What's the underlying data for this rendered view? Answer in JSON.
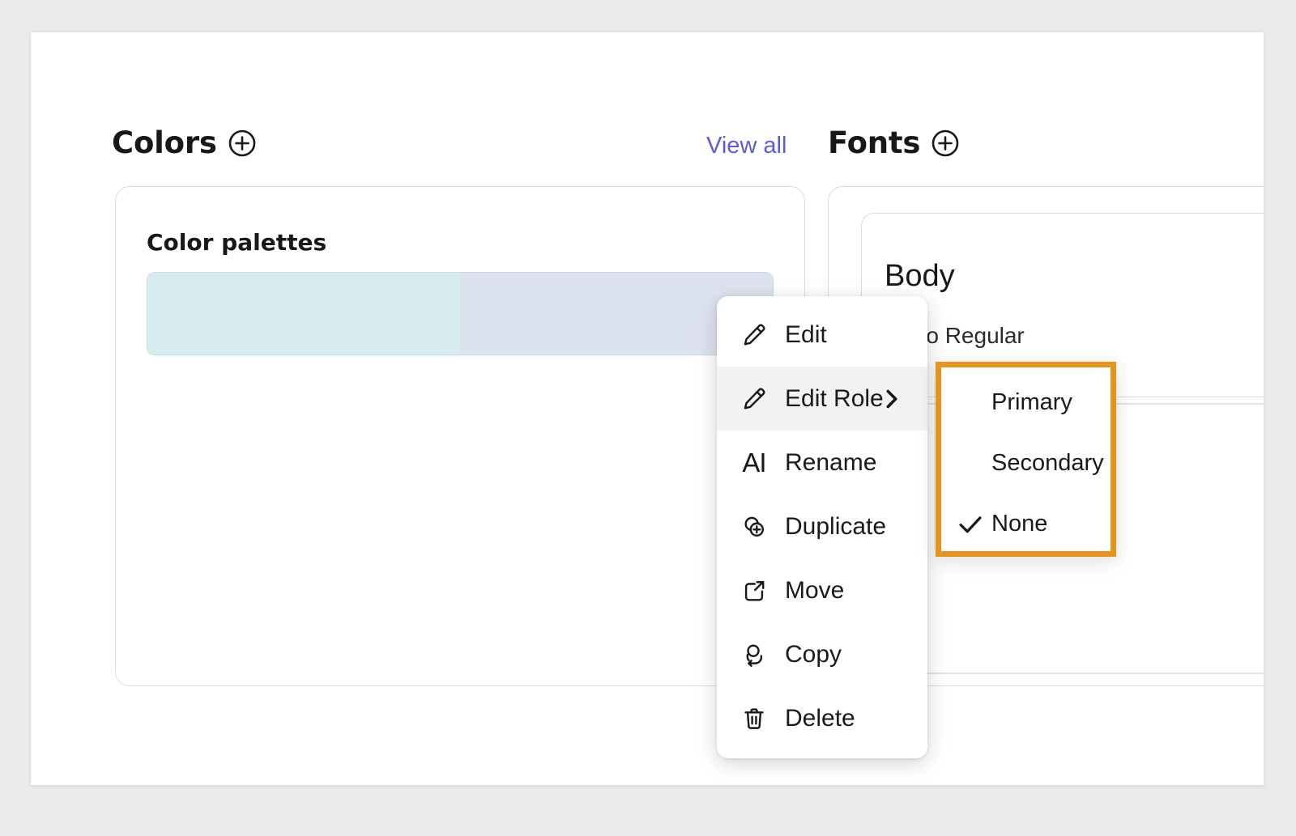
{
  "theme": {
    "page_background": "#eaeaea",
    "card_background": "#ffffff",
    "accent_link": "#5a5ce0",
    "highlight_border": "#e8931e",
    "text_primary": "#18181a",
    "panel_border": "#dcdcdc"
  },
  "colors_section": {
    "title": "Colors",
    "add_icon": "plus-circle-icon",
    "view_all_label": "View all",
    "panel": {
      "subtitle": "Color palettes",
      "palette": {
        "swatches": [
          {
            "name": "swatch-mint",
            "color": "#d7ecef",
            "width_pct": 50
          },
          {
            "name": "swatch-periwinkle",
            "color": "#dde2ef",
            "width_pct": 50
          }
        ]
      }
    }
  },
  "fonts_section": {
    "title": "Fonts",
    "add_icon": "plus-circle-icon",
    "font_card": {
      "name": "Body",
      "style": "n Pro Regular"
    }
  },
  "context_menu": {
    "items": [
      {
        "label": "Edit",
        "icon": "pencil-icon",
        "active": false,
        "has_submenu": false
      },
      {
        "label": "Edit Role",
        "icon": "pencil-icon",
        "active": true,
        "has_submenu": true,
        "chevron": "chevron-right-icon"
      },
      {
        "label": "Rename",
        "icon": "text-ai-icon",
        "active": false,
        "has_submenu": false,
        "glyph": "AI"
      },
      {
        "label": "Duplicate",
        "icon": "duplicate-icon",
        "active": false,
        "has_submenu": false
      },
      {
        "label": "Move",
        "icon": "move-icon",
        "active": false,
        "has_submenu": false
      },
      {
        "label": "Copy",
        "icon": "copy-icon",
        "active": false,
        "has_submenu": false
      },
      {
        "label": "Delete",
        "icon": "trash-icon",
        "active": false,
        "has_submenu": false
      }
    ]
  },
  "role_submenu": {
    "highlighted": true,
    "items": [
      {
        "label": "Primary",
        "checked": false
      },
      {
        "label": "Secondary",
        "checked": false
      },
      {
        "label": "None",
        "checked": true,
        "check_icon": "checkmark-icon"
      }
    ]
  }
}
